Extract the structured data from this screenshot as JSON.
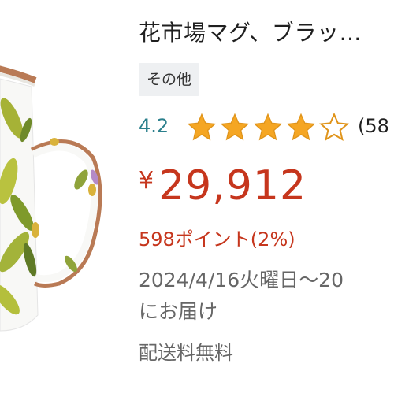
{
  "product": {
    "title": "花市場マグ、ブラッ…",
    "category_chip": "その他",
    "rating_value": "4.2",
    "rating_stars": 4.2,
    "rating_count": "(58",
    "price_currency": "¥",
    "price_amount": "29,912",
    "points": "598ポイント(2%)",
    "delivery_line1": "2024/4/16火曜日〜20",
    "delivery_line2": "にお届け",
    "shipping": "配送料無料"
  },
  "colors": {
    "price": "#c6361d",
    "rating_text": "#2a7f8c",
    "star_fill": "#f5a623",
    "chip_bg": "#eef0f2"
  }
}
